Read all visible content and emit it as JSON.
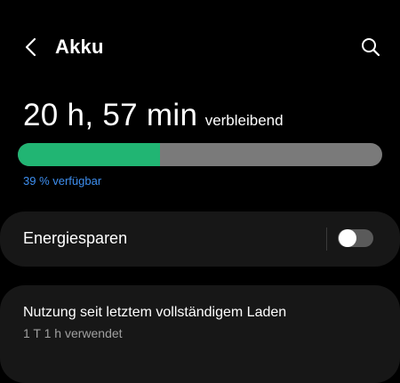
{
  "header": {
    "title": "Akku",
    "back_icon": "chevron-left-icon",
    "search_icon": "search-icon"
  },
  "battery": {
    "remaining_time": "20 h, 57 min",
    "remaining_suffix": "verbleibend",
    "level_percent": 39,
    "available_text": "39 % verfügbar",
    "fill_color": "#21b573",
    "track_color": "#7a7a7a",
    "available_color": "#3e8ff0"
  },
  "power_saving": {
    "label": "Energiesparen",
    "enabled": false
  },
  "usage": {
    "title": "Nutzung seit letztem vollständigem Laden",
    "subtitle": "1 T 1 h verwendet"
  }
}
